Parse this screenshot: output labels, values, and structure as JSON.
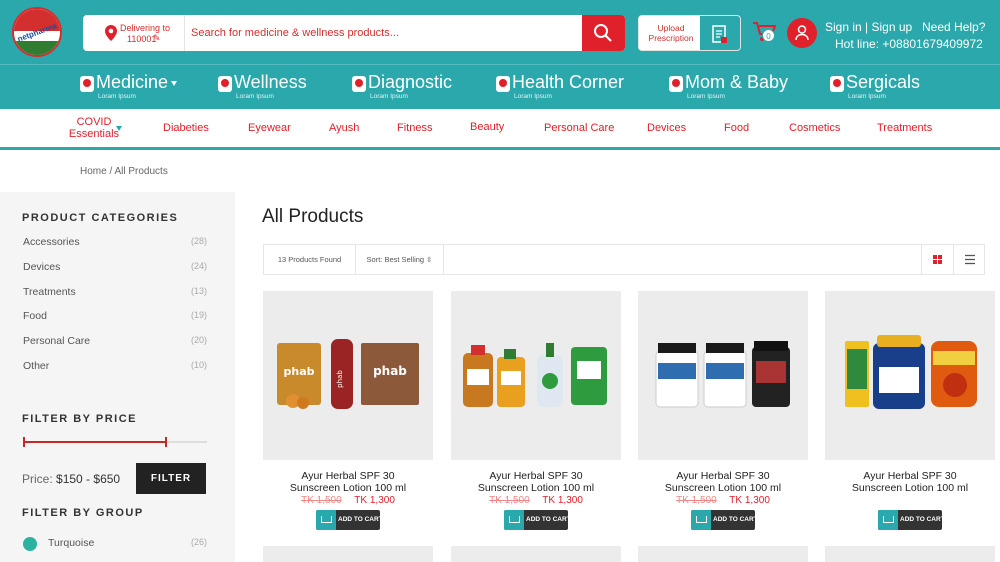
{
  "brand": {
    "logo_text": "netpharma"
  },
  "header": {
    "delivery_label": "Delivering to",
    "delivery_code": "110001",
    "search_placeholder": "Search for medicine & wellness products...",
    "upload_label": "Upload Prescription",
    "cart_count": "0",
    "signin_label": "Sign in | Sign up",
    "help_label": "Need Help?",
    "hotline": "Hot line: +08801679409972"
  },
  "categories": [
    {
      "label": "Medicine",
      "sub": "Loram Ipsum",
      "has_dropdown": true
    },
    {
      "label": "Wellness",
      "sub": "Loram Ipsum"
    },
    {
      "label": "Diagnostic",
      "sub": "Loram Ipsum"
    },
    {
      "label": "Health Corner",
      "sub": "Loram Ipsum"
    },
    {
      "label": "Mom & Baby",
      "sub": "Loram Ipsum"
    },
    {
      "label": "Sergicals",
      "sub": "Loram Ipsum"
    }
  ],
  "subcategories": {
    "covid_line1": "COVID",
    "covid_line2": "Essentials",
    "items": [
      "Diabeties",
      "Eyewear",
      "Ayush",
      "Fitness",
      "Beauty",
      "Personal Care",
      "Devices",
      "Food",
      "Cosmetics",
      "Treatments"
    ]
  },
  "breadcrumb": "Home / All Products",
  "sidebar": {
    "categories_heading": "PRODUCT CATEGORIES",
    "categories": [
      {
        "label": "Accessories",
        "count": "(28)"
      },
      {
        "label": "Devices",
        "count": "(24)"
      },
      {
        "label": "Treatments",
        "count": "(13)"
      },
      {
        "label": "Food",
        "count": "(19)"
      },
      {
        "label": "Personal Care",
        "count": "(20)"
      },
      {
        "label": "Other",
        "count": "(10)"
      }
    ],
    "price_heading": "FILTER BY PRICE",
    "price_label": "Price:",
    "price_range": "$150 - $650",
    "price_slider": {
      "min_fraction": 0.0,
      "max_fraction": 0.78
    },
    "filter_button": "FILTER",
    "group_heading": "FILTER BY GROUP",
    "groups": [
      {
        "label": "Turquoise",
        "count": "(26)",
        "color": "#2bb3a0"
      }
    ]
  },
  "main": {
    "title": "All Products",
    "found_text": "13 Products Found",
    "sort_text": "Sort: Best Selling ⇳",
    "view_mode": "grid"
  },
  "products": [
    {
      "name_line1": "Ayur Herbal SPF 30",
      "name_line2": "Sunscreen Lotion 100 ml",
      "old_price": "TK 1,500",
      "new_price": "TK 1,300",
      "add_label": "ADD TO CART",
      "image": "phab-pack-icon"
    },
    {
      "name_line1": "Ayur Herbal SPF 30",
      "name_line2": "Sunscreen Lotion 100 ml",
      "old_price": "TK 1,500",
      "new_price": "TK 1,300",
      "add_label": "ADD TO CART",
      "image": "dettol-bottles-icon"
    },
    {
      "name_line1": "Ayur Herbal SPF 30",
      "name_line2": "Sunscreen Lotion 100 ml",
      "old_price": "TK 1,500",
      "new_price": "TK 1,300",
      "add_label": "ADD TO CART",
      "image": "supplement-jars-icon"
    },
    {
      "name_line1": "Ayur Herbal SPF 30",
      "name_line2": "Sunscreen Lotion 100 ml",
      "old_price": "",
      "new_price": "",
      "add_label": "ADD TO CART",
      "image": "srisri-jars-icon"
    }
  ],
  "colors": {
    "teal": "#2aa8ac",
    "red": "#e0202a",
    "dark": "#222222"
  }
}
